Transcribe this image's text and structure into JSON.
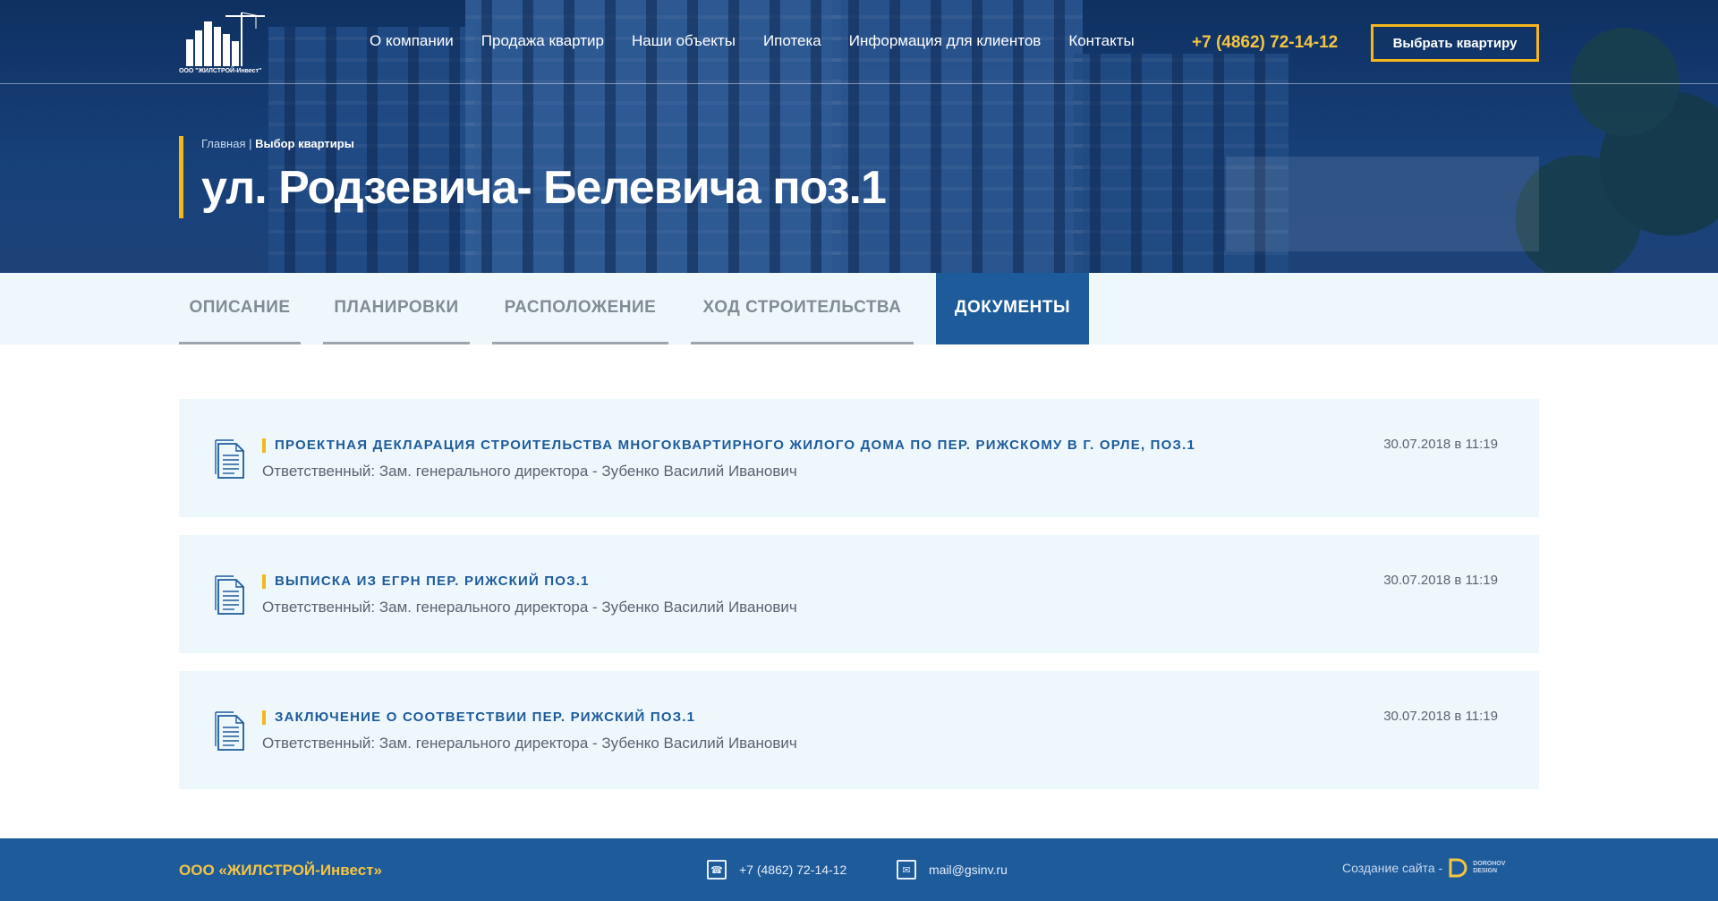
{
  "header": {
    "logo_text": "ООО \"ЖИЛСТРОЙ-Инвест\"",
    "nav": [
      "О компании",
      "Продажа квартир",
      "Наши объекты",
      "Ипотека",
      "Информация для клиентов",
      "Контакты"
    ],
    "phone": "+7 (4862) 72-14-12",
    "cta_label": "Выбрать квартиру"
  },
  "hero": {
    "breadcrumb_home": "Главная",
    "breadcrumb_sep": " | ",
    "breadcrumb_current": "Выбор квартиры",
    "title": "ул. Родзевича- Белевича поз.1"
  },
  "tabs": [
    {
      "label": "ОПИСАНИЕ",
      "active": false
    },
    {
      "label": "ПЛАНИРОВКИ",
      "active": false
    },
    {
      "label": "РАСПОЛОЖЕНИЕ",
      "active": false
    },
    {
      "label": "ХОД СТРОИТЕЛЬСТВА",
      "active": false
    },
    {
      "label": "ДОКУМЕНТЫ",
      "active": true
    }
  ],
  "documents": [
    {
      "title": "ПРОЕКТНАЯ ДЕКЛАРАЦИЯ СТРОИТЕЛЬСТВА МНОГОКВАРТИРНОГО ЖИЛОГО ДОМА ПО ПЕР. РИЖСКОМУ В Г. ОРЛЕ, ПОЗ.1",
      "responsible": "Ответственный: Зам. генерального директора - Зубенко Василий Иванович",
      "date": "30.07.2018 в 11:19"
    },
    {
      "title": "ВЫПИСКА ИЗ ЕГРН ПЕР. РИЖСКИЙ ПОЗ.1",
      "responsible": "Ответственный: Зам. генерального директора - Зубенко Василий Иванович",
      "date": "30.07.2018 в 11:19"
    },
    {
      "title": "ЗАКЛЮЧЕНИЕ О СООТВЕТСТВИИ ПЕР. РИЖСКИЙ ПОЗ.1",
      "responsible": "Ответственный: Зам. генерального директора - Зубенко Василий Иванович",
      "date": "30.07.2018 в 11:19"
    }
  ],
  "footer": {
    "company": "ООО «ЖИЛСТРОЙ-Инвест»",
    "phone": "+7 (4862) 72-14-12",
    "email": "mail@gsinv.ru",
    "credit_label": "Создание сайта -",
    "credit_brand_line1": "DOROHOV",
    "credit_brand_line2": "DESIGN"
  },
  "colors": {
    "accent": "#f5b71c",
    "primary": "#1d5b9b",
    "panel": "#eef7fc"
  }
}
